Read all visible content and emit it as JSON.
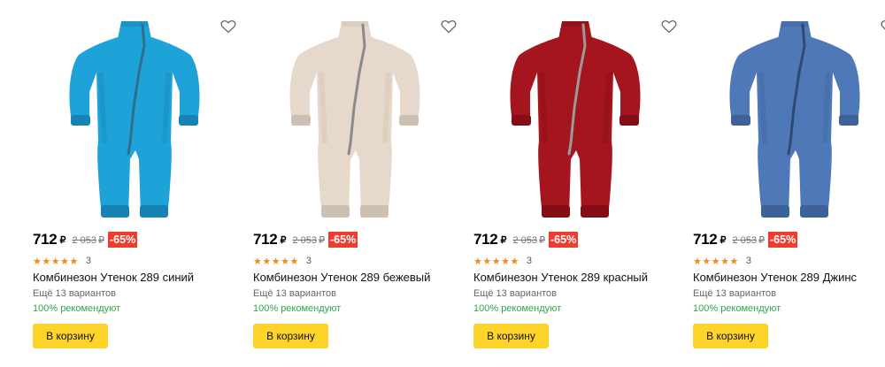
{
  "currency": "₽",
  "products": [
    {
      "price": "712",
      "old_price": "2 053",
      "discount": "-65%",
      "stars": "★★★★★",
      "review_count": "3",
      "title": "Комбинезон Утенок 289 синий",
      "variants": "Ещё 13 вариантов",
      "recommend": "100% рекомендуют",
      "cart_label": "В корзину",
      "color": "#1ea3d8",
      "shade": "#1583b3",
      "zip": "#2d6f8f",
      "favorite_icon": "heart-outline-icon"
    },
    {
      "price": "712",
      "old_price": "2 053",
      "discount": "-65%",
      "stars": "★★★★★",
      "review_count": "3",
      "title": "Комбинезон Утенок 289 бежевый",
      "variants": "Ещё 13 вариантов",
      "recommend": "100% рекомендуют",
      "cart_label": "В корзину",
      "color": "#e6d8ca",
      "shade": "#cdbfb1",
      "zip": "#8b8b8b",
      "favorite_icon": "heart-outline-icon"
    },
    {
      "price": "712",
      "old_price": "2 053",
      "discount": "-65%",
      "stars": "★★★★★",
      "review_count": "3",
      "title": "Комбинезон Утенок 289 красный",
      "variants": "Ещё 13 вариантов",
      "recommend": "100% рекомендуют",
      "cart_label": "В корзину",
      "color": "#a5151e",
      "shade": "#850e16",
      "zip": "#9a9a9a",
      "favorite_icon": "heart-outline-icon"
    },
    {
      "price": "712",
      "old_price": "2 053",
      "discount": "-65%",
      "stars": "★★★★★",
      "review_count": "3",
      "title": "Комбинезон Утенок 289 Джинс",
      "variants": "Ещё 13 вариантов",
      "recommend": "100% рекомендуют",
      "cart_label": "В корзину",
      "color": "#4f78b8",
      "shade": "#3d6299",
      "zip": "#2e4a72",
      "favorite_icon": "heart-outline-icon"
    }
  ]
}
